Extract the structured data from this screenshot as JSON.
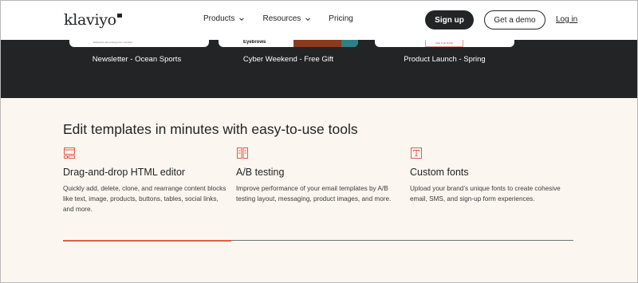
{
  "header": {
    "logo_text": "klaviyo",
    "nav": [
      {
        "label": "Products",
        "has_dropdown": true
      },
      {
        "label": "Resources",
        "has_dropdown": true
      },
      {
        "label": "Pricing",
        "has_dropdown": false
      }
    ],
    "signup_label": "Sign up",
    "demo_label": "Get a demo",
    "login_label": "Log in"
  },
  "templates": [
    {
      "title": "Newsletter - Ocean Sports",
      "preview_text": "Ethiquette alexa dangerous suruthira"
    },
    {
      "title": "Cyber Weekend - Free Gift",
      "preview_text": "Eyebrows"
    },
    {
      "title": "Product Launch - Spring",
      "preview_text": "SEE THE SHOE"
    }
  ],
  "section": {
    "title": "Edit templates in minutes with easy-to-use tools",
    "features": [
      {
        "icon": "html-editor-icon",
        "title": "Drag-and-drop HTML editor",
        "description": "Quickly add, delete, clone, and rearrange content blocks like text, image, products, buttons, tables, social links, and more."
      },
      {
        "icon": "ab-testing-icon",
        "title": "A/B testing",
        "description": "Improve performance of your email templates by A/B testing layout, messaging, product images, and more."
      },
      {
        "icon": "font-icon",
        "title": "Custom fonts",
        "description": "Upload your brand’s unique fonts to create cohesive email, SMS, and sign-up form experiences."
      }
    ],
    "carousel_progress": 0.33
  },
  "colors": {
    "dark": "#232426",
    "cream": "#fcf6f0",
    "accent": "#e05d45"
  }
}
